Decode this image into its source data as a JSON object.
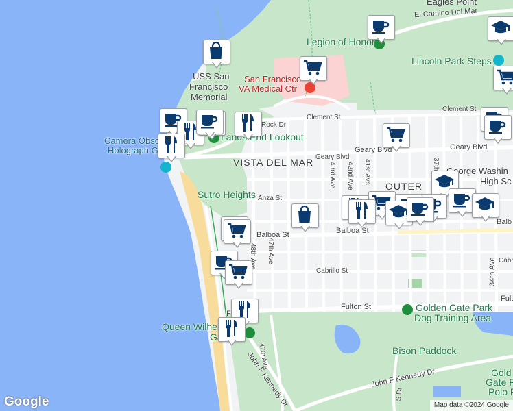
{
  "map": {
    "colors": {
      "water": "#8ab4f8",
      "park": "#c8e6c9",
      "urban": "#f1f3f4",
      "road": "#ffffff",
      "beach": "#f7dc9b",
      "medical": "#fbd3d3",
      "marker_icon": "#0b3b6e"
    },
    "places": {
      "eagles_point": "Eagles Point",
      "legion_of_honor": "Legion of Honor",
      "va_medical_line1": "San Francisco",
      "va_medical_line2": "VA Medical Ctr",
      "uss_sf_line1": "USS San",
      "uss_sf_line2": "Francisco",
      "uss_sf_line3": "Memorial",
      "lands_end": "Lands End Lookout",
      "camera_line1": "Camera Obscu",
      "camera_line2": "Holograph G",
      "lincoln_park_steps": "Lincoln Park Steps",
      "sutro_heights": "Sutro Heights",
      "vista_del_mar": "VISTA DEL MAR",
      "outer": "OUTER",
      "gw_line1": "George Washin",
      "gw_line2": "High Sc",
      "queen_line1": "Queen Wilhel",
      "queen_line2": "Ga",
      "dog_line1": "Golden Gate Park",
      "dog_line2": "Dog Training Area",
      "bison": "Bison Paddock",
      "polo_line1": "Gold",
      "polo_line2": "Gate P",
      "polo_line3": "Polo F"
    },
    "streets": {
      "el_camino": "El Camino Del Mar",
      "clement_w": "Clement St",
      "clement_e": "Clement St",
      "rock": "Rock Dr",
      "geary_blvd_w": "Geary Blvd",
      "geary_blvd_e": "Geary Blvd",
      "geary_blvd_small": "Geary Blvd",
      "anza": "Anza St",
      "balboa_w": "Balboa St",
      "balboa_e": "Balboa St",
      "balboa_far": "Balb",
      "cabrillo": "Cabrillo St",
      "cabr_far": "Cabr",
      "fulton": "Fulton St",
      "fulton_far": "Fult",
      "fulton_w": "F",
      "fulton_w2": "ult",
      "jfk_w": "John F Kennedy Dr",
      "jfk_e": "John F Kennedy Dr",
      "ave_43": "43rd Ave",
      "ave_42": "42nd Ave",
      "ave_41": "41st Ave",
      "ave_37": "37th",
      "ave_34": "34th Ave",
      "ave_47": "47th Ave",
      "ave_48": "48th Ave",
      "ave_47_lower": "47th Ave",
      "dr_s": "S Dr"
    },
    "logo": "Google",
    "attribution": "Map data ©2024 Google"
  }
}
